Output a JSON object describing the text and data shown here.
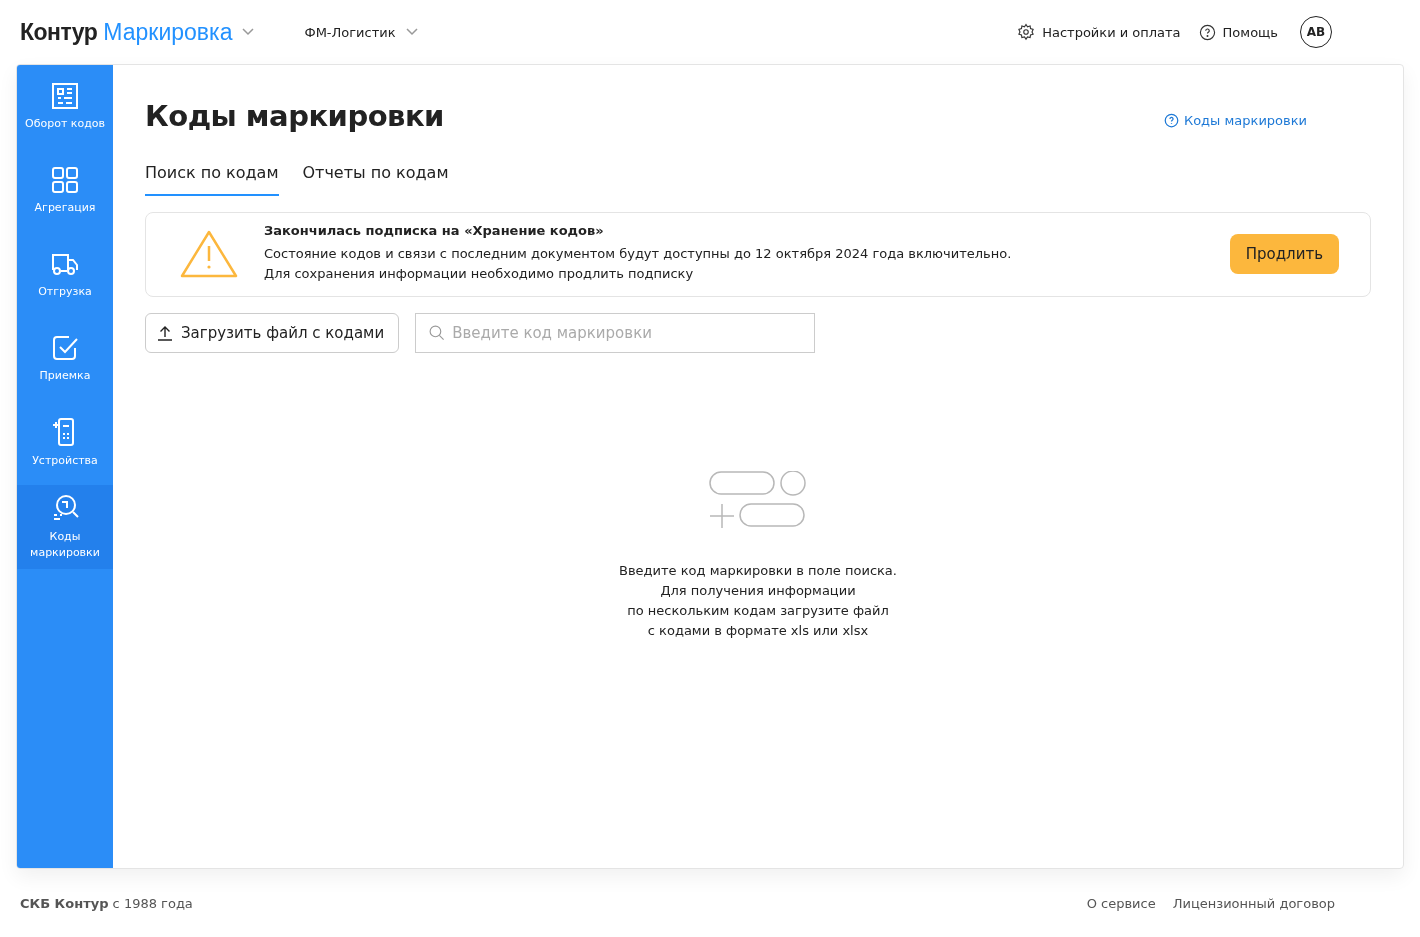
{
  "header": {
    "brand": "Контур",
    "product": "Маркировка",
    "organization": "ФМ-Логистик",
    "links": [
      {
        "kind": "settings",
        "label": "Настройки и оплата"
      },
      {
        "kind": "help",
        "label": "Помощь"
      }
    ],
    "avatar": "АВ"
  },
  "sidebar": {
    "items": [
      {
        "kind": "codes",
        "label": "Оборот кодов",
        "selected": false
      },
      {
        "kind": "aggregation",
        "label": "Агрегация",
        "selected": false
      },
      {
        "kind": "shipment",
        "label": "Отгрузка",
        "selected": false
      },
      {
        "kind": "acceptance",
        "label": "Приемка",
        "selected": false
      },
      {
        "kind": "devices",
        "label": "Устройства",
        "selected": false
      },
      {
        "kind": "search",
        "label": "Коды маркировки",
        "selected": true
      }
    ]
  },
  "page": {
    "title": "Коды маркировки",
    "help_link": "Коды маркировки",
    "tabs": [
      {
        "label": "Поиск по кодам",
        "selected": true
      },
      {
        "label": "Отчеты по кодам",
        "selected": false
      }
    ],
    "alert": {
      "title": "Закончилась подписка на «Хранение кодов»",
      "text": "Состояние кодов и связи с последним документом будут доступны до 12 октября 2024 года включительно.\nДля сохранения информации необходимо продлить подписку",
      "action": "Продлить"
    },
    "upload_button": "Загрузить файл с кодами",
    "search": {
      "placeholder": "Введите код маркировки"
    },
    "empty_text": "Введите код маркировки в поле поиска.\nДля получения информации\nпо нескольким кодам загрузите файл\nс кодами в формате xls или xlsx"
  },
  "footer": {
    "copyright": "**СКБ Контур** с 1988 года",
    "links": [
      "О сервисе",
      "Лицензионный договор"
    ]
  }
}
